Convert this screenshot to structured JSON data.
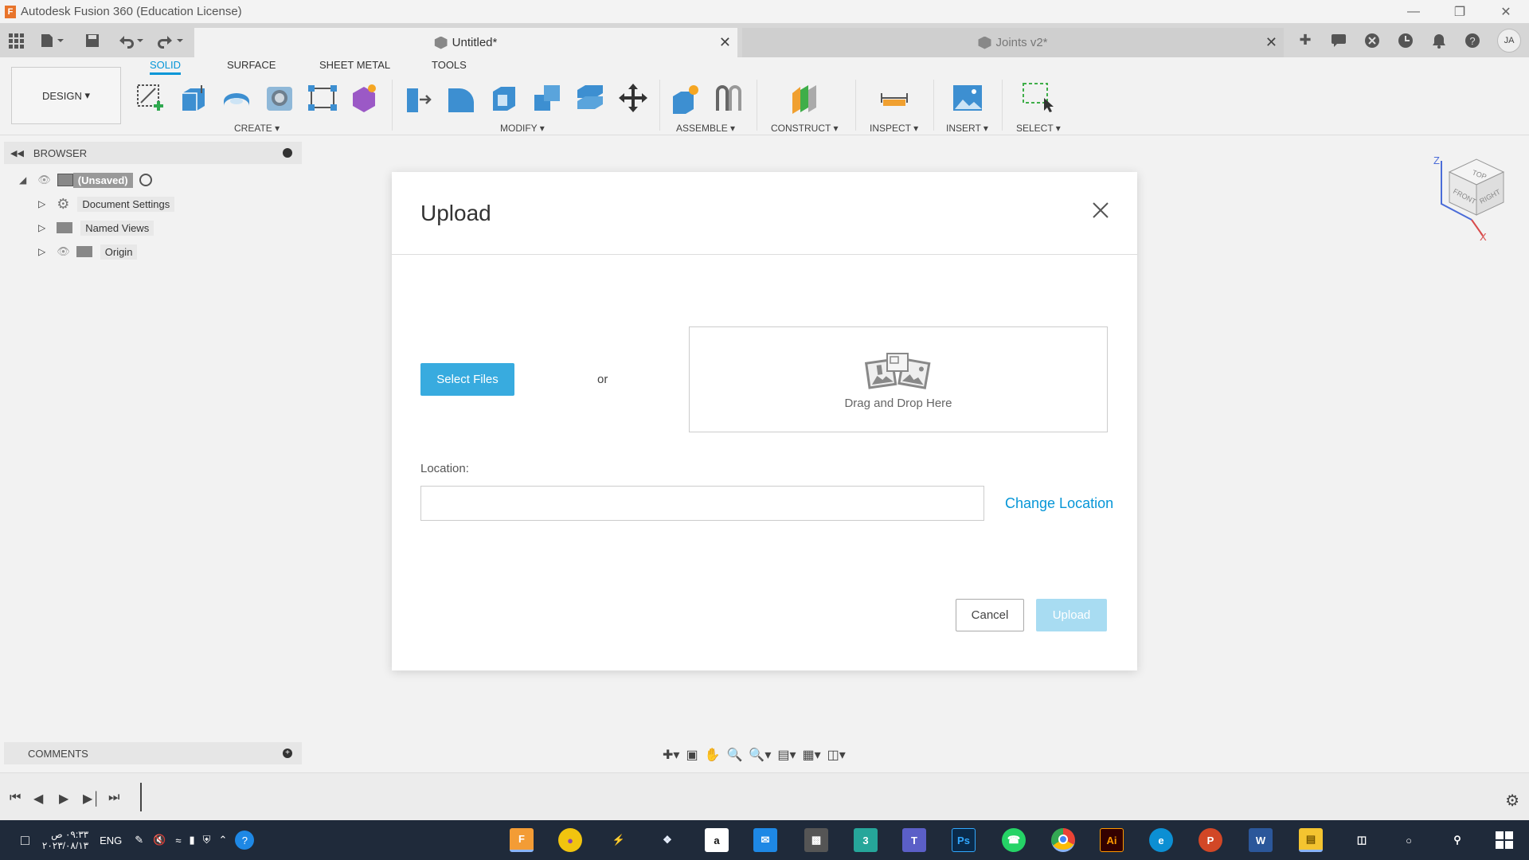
{
  "window": {
    "title": "Autodesk Fusion 360 (Education License)",
    "app_icon_letter": "F"
  },
  "tabs": {
    "active": "Untitled*",
    "inactive": "Joints v2*"
  },
  "user": {
    "initials": "JA"
  },
  "toolbar": {
    "design_label": "DESIGN",
    "ribbon_tabs": [
      "SOLID",
      "SURFACE",
      "SHEET METAL",
      "TOOLS"
    ],
    "groups": [
      "CREATE",
      "MODIFY",
      "ASSEMBLE",
      "CONSTRUCT",
      "INSPECT",
      "INSERT",
      "SELECT"
    ]
  },
  "browser": {
    "title": "BROWSER",
    "root": "(Unsaved)",
    "items": [
      "Document Settings",
      "Named Views",
      "Origin"
    ]
  },
  "dialog": {
    "title": "Upload",
    "select_files": "Select Files",
    "or": "or",
    "drop_text": "Drag and Drop Here",
    "location_label": "Location:",
    "location_value": "",
    "change_location": "Change Location",
    "cancel": "Cancel",
    "upload": "Upload"
  },
  "viewcube": {
    "top": "TOP",
    "front": "FRONT",
    "right": "RIGHT",
    "z": "Z",
    "x": "X"
  },
  "comments": {
    "title": "COMMENTS"
  },
  "taskbar": {
    "time": "٠٩:٣٣ ص",
    "date": "٢٠٢٣/٠٨/١٣",
    "lang": "ENG"
  },
  "colors": {
    "accent": "#0696d7",
    "primary_button": "#38abdf",
    "disabled_button": "#a8dcf2",
    "taskbar": "#1f2a3a"
  }
}
